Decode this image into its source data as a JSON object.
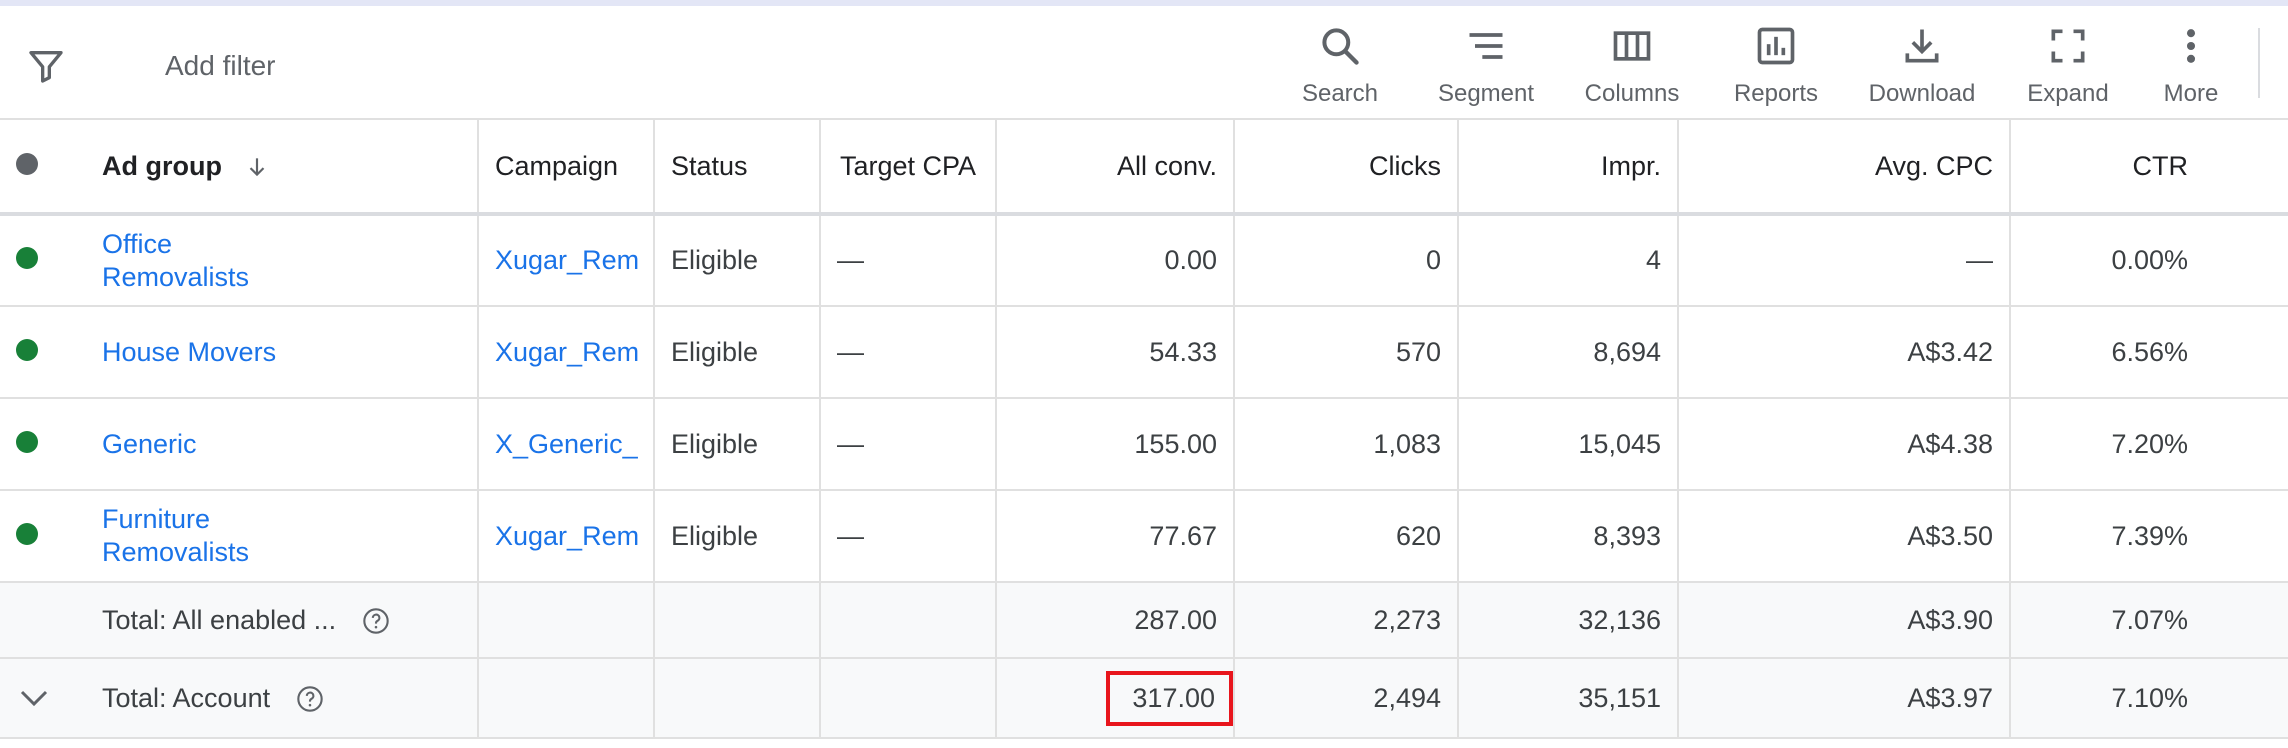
{
  "toolbar": {
    "add_filter": "Add filter",
    "tools": [
      {
        "label": "Search",
        "icon": "search-icon"
      },
      {
        "label": "Segment",
        "icon": "segment-icon"
      },
      {
        "label": "Columns",
        "icon": "columns-icon"
      },
      {
        "label": "Reports",
        "icon": "reports-icon"
      },
      {
        "label": "Download",
        "icon": "download-icon"
      },
      {
        "label": "Expand",
        "icon": "expand-icon"
      },
      {
        "label": "More",
        "icon": "more-vert-icon"
      }
    ]
  },
  "colors": {
    "link": "#1a73e8",
    "status_green": "#188038",
    "highlight": "#e8151c",
    "total_bg": "#f8f9fa"
  },
  "table": {
    "headers": {
      "ad_group": "Ad group",
      "campaign": "Campaign",
      "status": "Status",
      "target_cpa": "Target CPA",
      "all_conv": "All conv.",
      "clicks": "Clicks",
      "impr": "Impr.",
      "avg_cpc": "Avg. CPC",
      "ctr": "CTR"
    },
    "rows": [
      {
        "ad_group": "Office Removalists",
        "campaign": "Xugar_Rem",
        "status": "Eligible",
        "target_cpa": "—",
        "all_conv": "0.00",
        "clicks": "0",
        "impr": "4",
        "avg_cpc": "—",
        "ctr": "0.00%"
      },
      {
        "ad_group": "House Movers",
        "campaign": "Xugar_Rem",
        "status": "Eligible",
        "target_cpa": "—",
        "all_conv": "54.33",
        "clicks": "570",
        "impr": "8,694",
        "avg_cpc": "A$3.42",
        "ctr": "6.56%"
      },
      {
        "ad_group": "Generic",
        "campaign": "X_Generic_",
        "status": "Eligible",
        "target_cpa": "—",
        "all_conv": "155.00",
        "clicks": "1,083",
        "impr": "15,045",
        "avg_cpc": "A$4.38",
        "ctr": "7.20%"
      },
      {
        "ad_group": "Furniture Removalists",
        "campaign": "Xugar_Rem",
        "status": "Eligible",
        "target_cpa": "—",
        "all_conv": "77.67",
        "clicks": "620",
        "impr": "8,393",
        "avg_cpc": "A$3.50",
        "ctr": "7.39%"
      }
    ],
    "totals": [
      {
        "label": "Total: All enabled ...",
        "all_conv": "287.00",
        "clicks": "2,273",
        "impr": "32,136",
        "avg_cpc": "A$3.90",
        "ctr": "7.07%"
      },
      {
        "label": "Total: Account",
        "all_conv": "317.00",
        "clicks": "2,494",
        "impr": "35,151",
        "avg_cpc": "A$3.97",
        "ctr": "7.10%"
      }
    ]
  }
}
